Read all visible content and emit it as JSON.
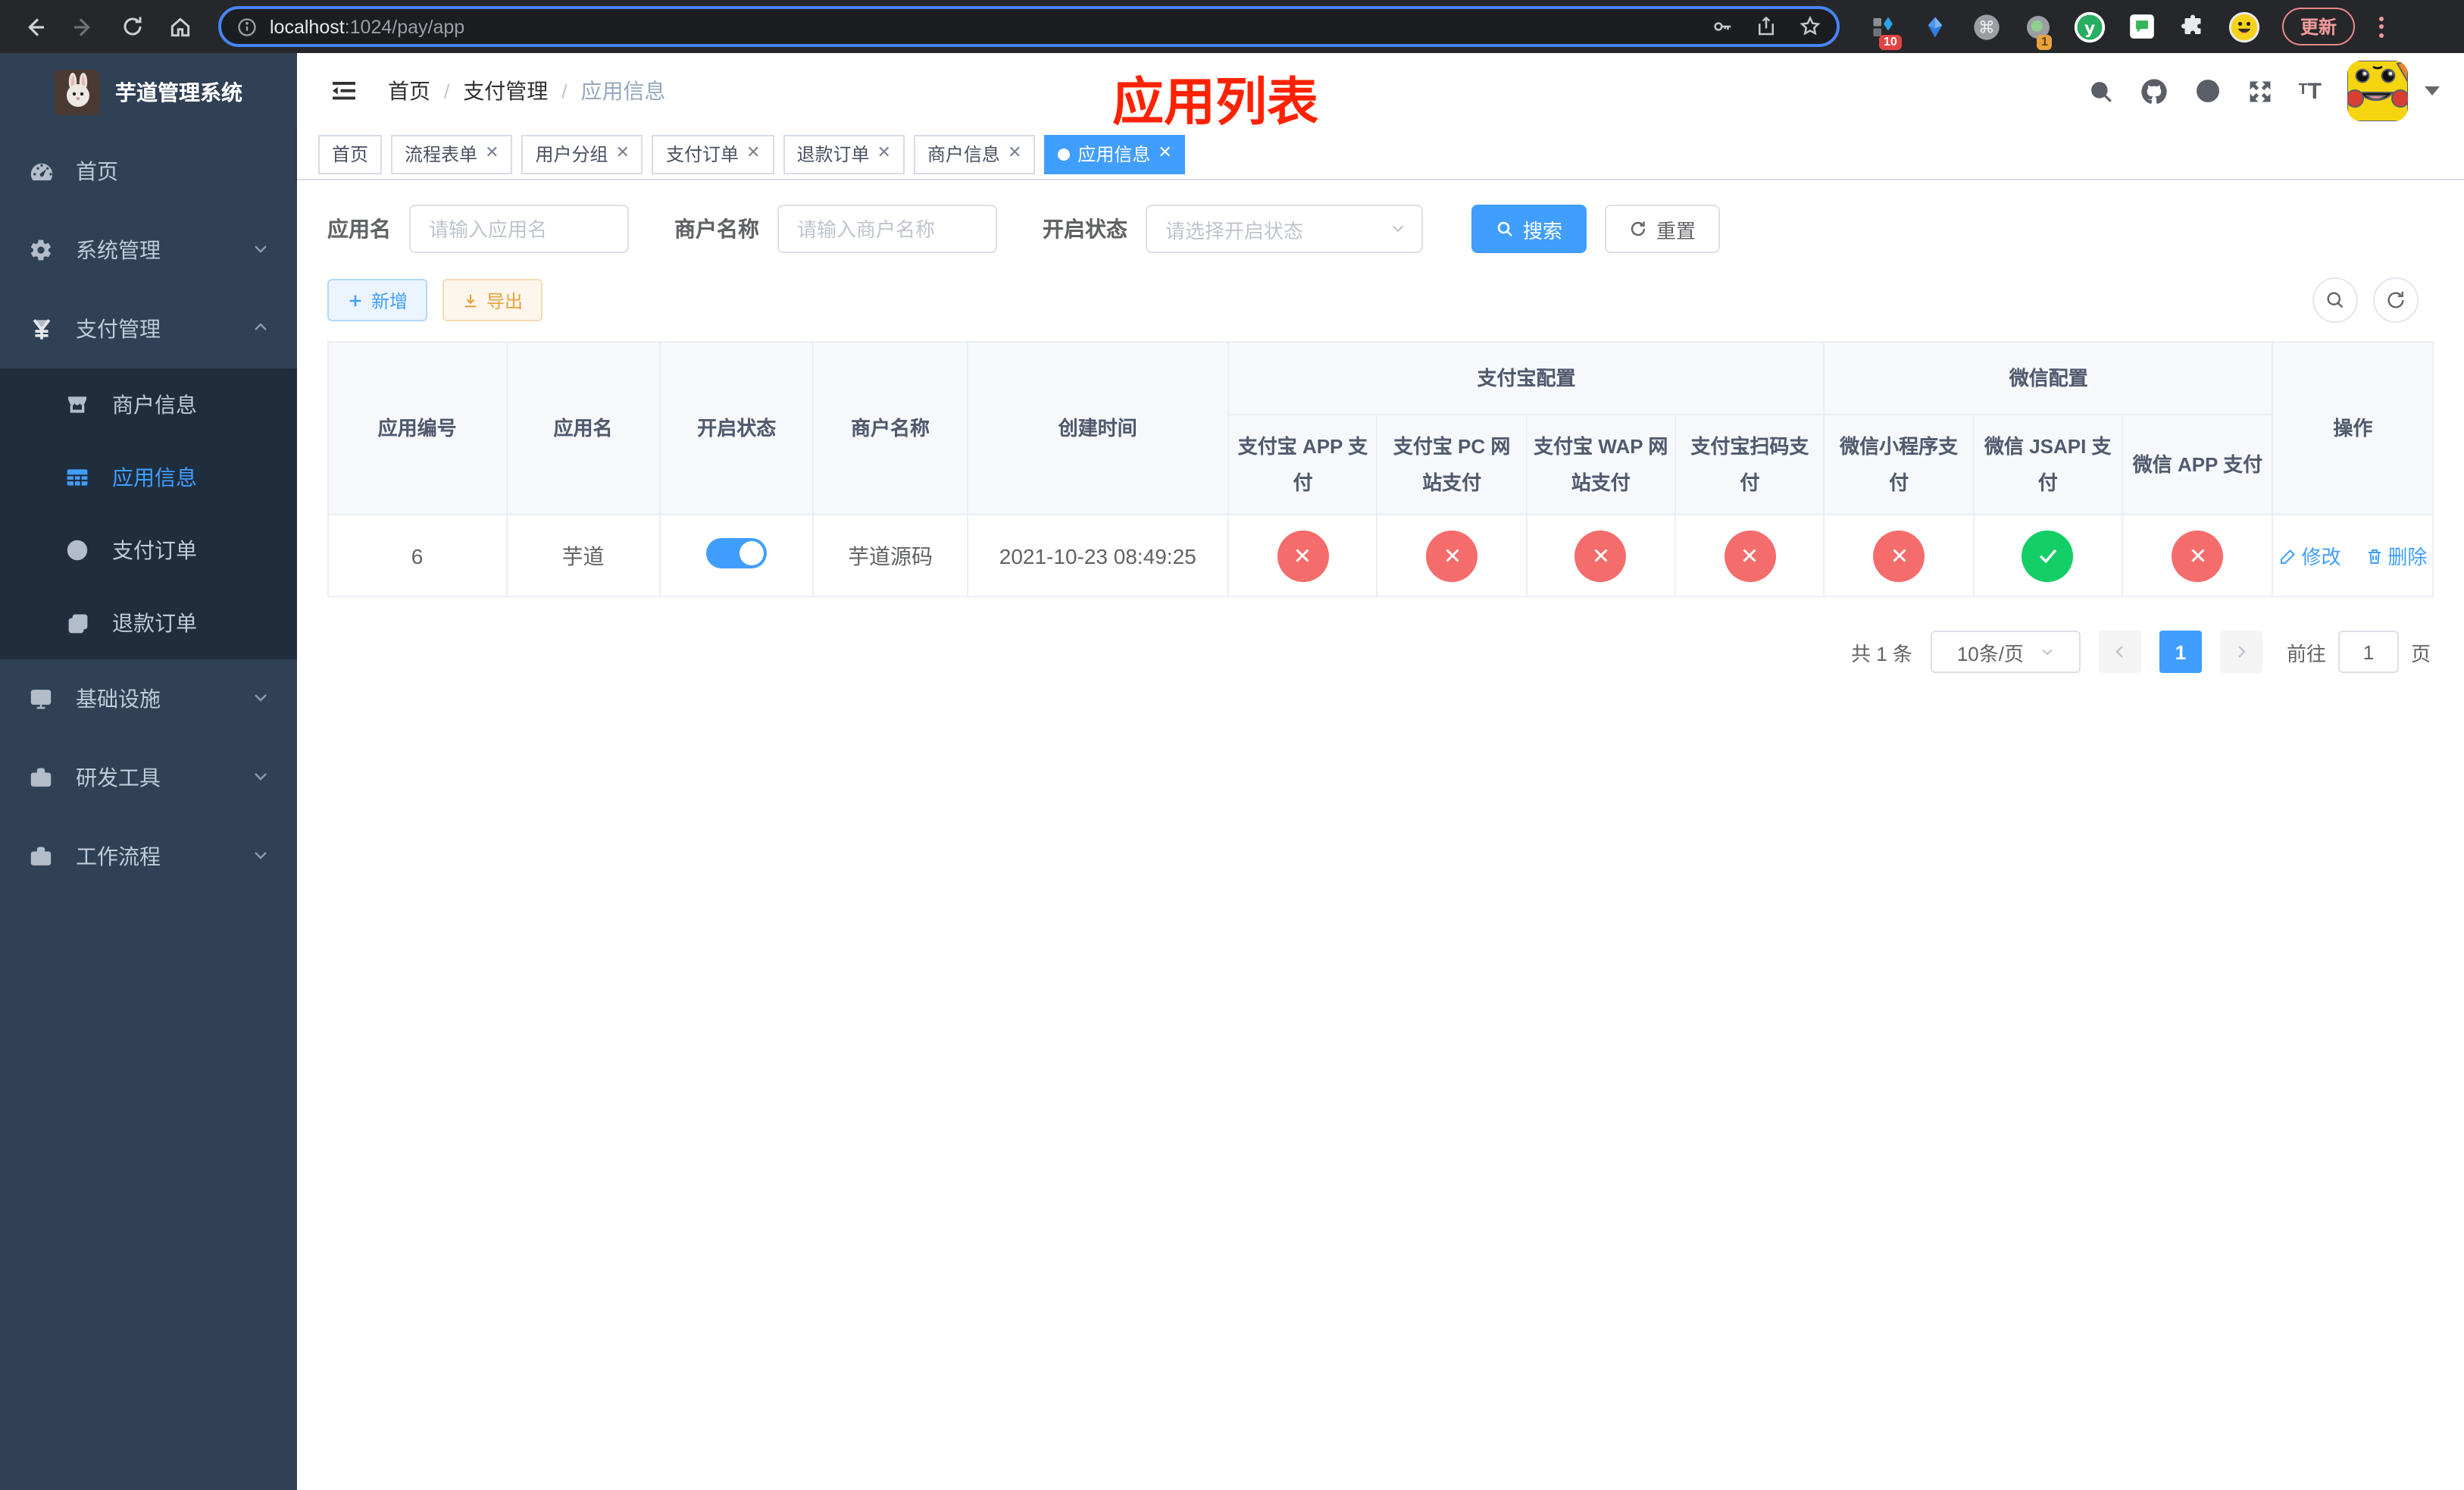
{
  "colors": {
    "accent": "#409eff",
    "success": "#13ce66",
    "danger": "#f56c6c",
    "warning": "#e6a23c",
    "annotation": "#ff2200",
    "sidebar_bg": "#304156",
    "submenu_bg": "#1f2d3d"
  },
  "browser": {
    "url_host": "localhost",
    "url_path": ":1024/pay/app",
    "ext_badge_1": "10",
    "ext_badge_2": "1",
    "update_label": "更新"
  },
  "sidebar": {
    "logo_title": "芋道管理系统",
    "items": [
      {
        "label": "首页"
      },
      {
        "label": "系统管理"
      },
      {
        "label": "支付管理"
      },
      {
        "label": "基础设施"
      },
      {
        "label": "研发工具"
      },
      {
        "label": "工作流程"
      }
    ],
    "pay_submenu": [
      {
        "label": "商户信息"
      },
      {
        "label": "应用信息"
      },
      {
        "label": "支付订单"
      },
      {
        "label": "退款订单"
      }
    ]
  },
  "navbar": {
    "breadcrumb": [
      "首页",
      "支付管理",
      "应用信息"
    ]
  },
  "annotation": "应用列表",
  "tabs": [
    {
      "label": "首页"
    },
    {
      "label": "流程表单"
    },
    {
      "label": "用户分组"
    },
    {
      "label": "支付订单"
    },
    {
      "label": "退款订单"
    },
    {
      "label": "商户信息"
    },
    {
      "label": "应用信息"
    }
  ],
  "filters": {
    "app_name_label": "应用名",
    "app_name_placeholder": "请输入应用名",
    "merchant_label": "商户名称",
    "merchant_placeholder": "请输入商户名称",
    "status_label": "开启状态",
    "status_placeholder": "请选择开启状态",
    "search_button": "搜索",
    "reset_button": "重置"
  },
  "toolbar": {
    "add_label": "新增",
    "export_label": "导出"
  },
  "table": {
    "group_alipay": "支付宝配置",
    "group_wechat": "微信配置",
    "col_id": "应用编号",
    "col_name": "应用名",
    "col_status": "开启状态",
    "col_merchant": "商户名称",
    "col_created": "创建时间",
    "col_alipay_app": "支付宝 APP 支付",
    "col_alipay_pc": "支付宝 PC 网站支付",
    "col_alipay_wap": "支付宝 WAP 网站支付",
    "col_alipay_qr": "支付宝扫码支付",
    "col_wx_mini": "微信小程序支付",
    "col_wx_jsapi": "微信 JSAPI 支付",
    "col_wx_app": "微信 APP 支付",
    "col_actions": "操作",
    "rows": [
      {
        "id": "6",
        "name": "芋道",
        "enabled": true,
        "merchant": "芋道源码",
        "created": "2021-10-23 08:49:25",
        "pay_status": [
          "no",
          "no",
          "no",
          "no",
          "no",
          "yes",
          "no"
        ],
        "edit_label": "修改",
        "delete_label": "删除"
      }
    ]
  },
  "pagination": {
    "total": "共 1 条",
    "page_size": "10条/页",
    "current_page": "1",
    "goto_label": "前往",
    "goto_value": "1",
    "page_unit": "页"
  }
}
